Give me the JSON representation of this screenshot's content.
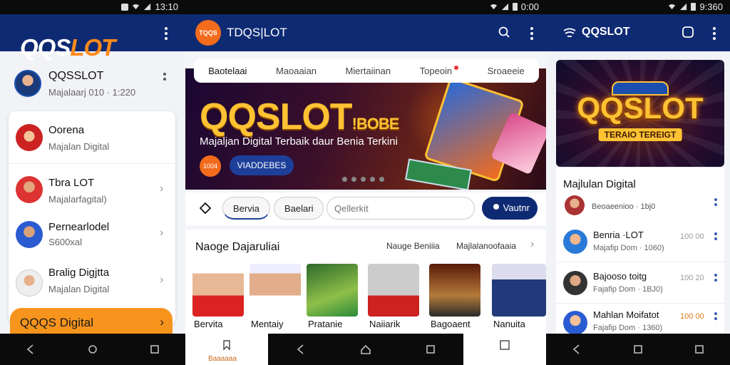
{
  "status": {
    "left_time": "13:10",
    "mid_time": "0:00",
    "right_time": "9:360"
  },
  "phone1": {
    "logo_white": "QQS",
    "logo_orange": "LOT",
    "profile": {
      "name": "QQSSLOT",
      "sub": "Majalaarj 010 · 1:220"
    },
    "items": [
      {
        "title": "Oorena",
        "sub": "Majalan Digital"
      },
      {
        "title": "Tbra LOT",
        "sub": "Majalarfagital)"
      },
      {
        "title": "Pernearlodel",
        "sub": "S600xal"
      },
      {
        "title": "Bralig Digjtta",
        "sub": "Majalan Digital"
      }
    ],
    "orange_button": "QQQS Digital"
  },
  "phone2": {
    "app_icon_text": "TQQS",
    "title": "TDQS|LOT",
    "tabs": [
      "Baotelaai",
      "Maoaaian",
      "Miertaiinan",
      "Topeoin",
      "Sroaeeie"
    ],
    "banner": {
      "title": "QQSLOT",
      "title_tail": "!BOBE",
      "subtitle": "Majaljan Digital Terbaik daur Benia Terkini",
      "badge": "1004",
      "cta": "VIADDEBES"
    },
    "search": {
      "pill1": "Bervia",
      "pill2": "Baelari",
      "placeholder": "Qellerkit",
      "button": "Vautnr"
    },
    "section": {
      "title": "Naoge Dajaruliai",
      "link1": "Nauge Beniiia",
      "link2": "Majlalanoofaaia",
      "thumbs": [
        "Bervita",
        "Mentaiy",
        "Pratanie",
        "Naiiarik",
        "Bagoaent",
        "Nanuita"
      ]
    },
    "bottom_label": "Baaaaaa"
  },
  "phone3": {
    "title": "QQSLOT",
    "banner_logo": "QQSLOT",
    "banner_sub": "TERAIO TEREIGT",
    "list_header": "Majlulan Digital",
    "header_sub": "Beoaeenioo · 1bj0",
    "items": [
      {
        "title": "Benria ·LOT",
        "sub": "Majafip Dom · 1060)",
        "value": "100 00"
      },
      {
        "title": "Bajooso toitg",
        "sub": "Fajafip Dom · 1BJ0)",
        "value": "100 20"
      },
      {
        "title": "Mahlan Moifatot",
        "sub": "Fajafip Dom · 1360)",
        "value": "100 00"
      }
    ]
  },
  "colors": {
    "appbar": "#0e2a73",
    "accent": "#f7941d",
    "primary_btn": "#0e2a73"
  }
}
